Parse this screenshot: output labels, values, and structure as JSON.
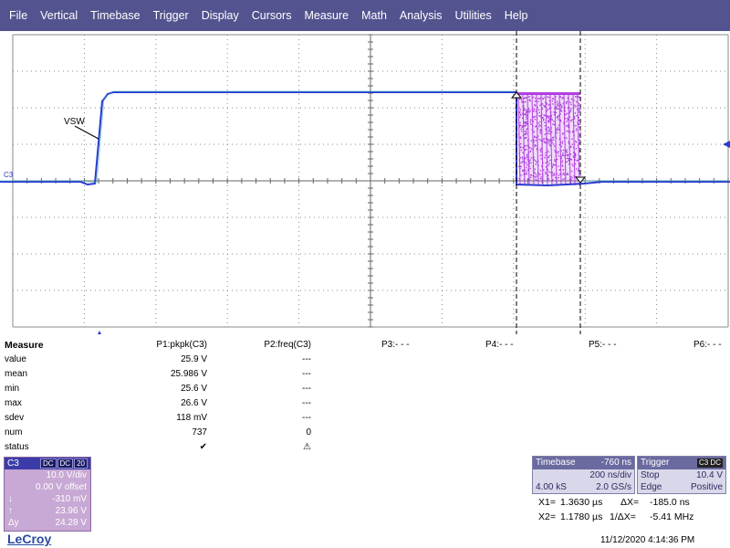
{
  "menu": [
    "File",
    "Vertical",
    "Timebase",
    "Trigger",
    "Display",
    "Cursors",
    "Measure",
    "Math",
    "Analysis",
    "Utilities",
    "Help"
  ],
  "scope": {
    "trace_label": "VSW",
    "channel_marker": "C3",
    "trace_color": "#2a3ad0",
    "persistence_color": "#b040e0",
    "grid_color": "#888888"
  },
  "measure": {
    "title": "Measure",
    "headers": [
      "P1:pkpk(C3)",
      "P2:freq(C3)",
      "P3:- - -",
      "P4:- - -",
      "P5:- - -",
      "P6:- - -"
    ],
    "rows": [
      {
        "label": "value",
        "p1": "25.9 V",
        "p2": "---"
      },
      {
        "label": "mean",
        "p1": "25.986 V",
        "p2": "---"
      },
      {
        "label": "min",
        "p1": "25.6 V",
        "p2": "---"
      },
      {
        "label": "max",
        "p1": "26.6 V",
        "p2": "---"
      },
      {
        "label": "sdev",
        "p1": "118 mV",
        "p2": "---"
      },
      {
        "label": "num",
        "p1": "737",
        "p2": "0"
      },
      {
        "label": "status",
        "p1": "✔",
        "p2": "⚠"
      }
    ]
  },
  "channel": {
    "name": "C3",
    "tags": [
      "DC",
      "DC",
      "20"
    ],
    "vdiv": "10.0 V/div",
    "offset": "0.00 V offset",
    "cursor1_symbol": "↓",
    "cursor1": "-310 mV",
    "cursor2_symbol": "↑",
    "cursor2": "23.96 V",
    "delta_symbol": "Δy",
    "delta": "24.28 V"
  },
  "logo": "LeCroy",
  "timebase": {
    "title": "Timebase",
    "delay": "-760 ns",
    "ns_div": "200 ns/div",
    "samples": "4.00 kS",
    "rate": "2.0 GS/s"
  },
  "trigger": {
    "title": "Trigger",
    "tag": "C3 DC",
    "mode": "Stop",
    "level": "10.4 V",
    "type": "Edge",
    "slope": "Positive"
  },
  "cursors": {
    "x1_label": "X1=",
    "x1": "1.3630 µs",
    "dx_label": "ΔX=",
    "dx": "-185.0 ns",
    "x2_label": "X2=",
    "x2": "1.1780 µs",
    "inv_label": "1/ΔX=",
    "inv": "-5.41 MHz"
  },
  "datetime": "11/12/2020 4:14:36 PM"
}
